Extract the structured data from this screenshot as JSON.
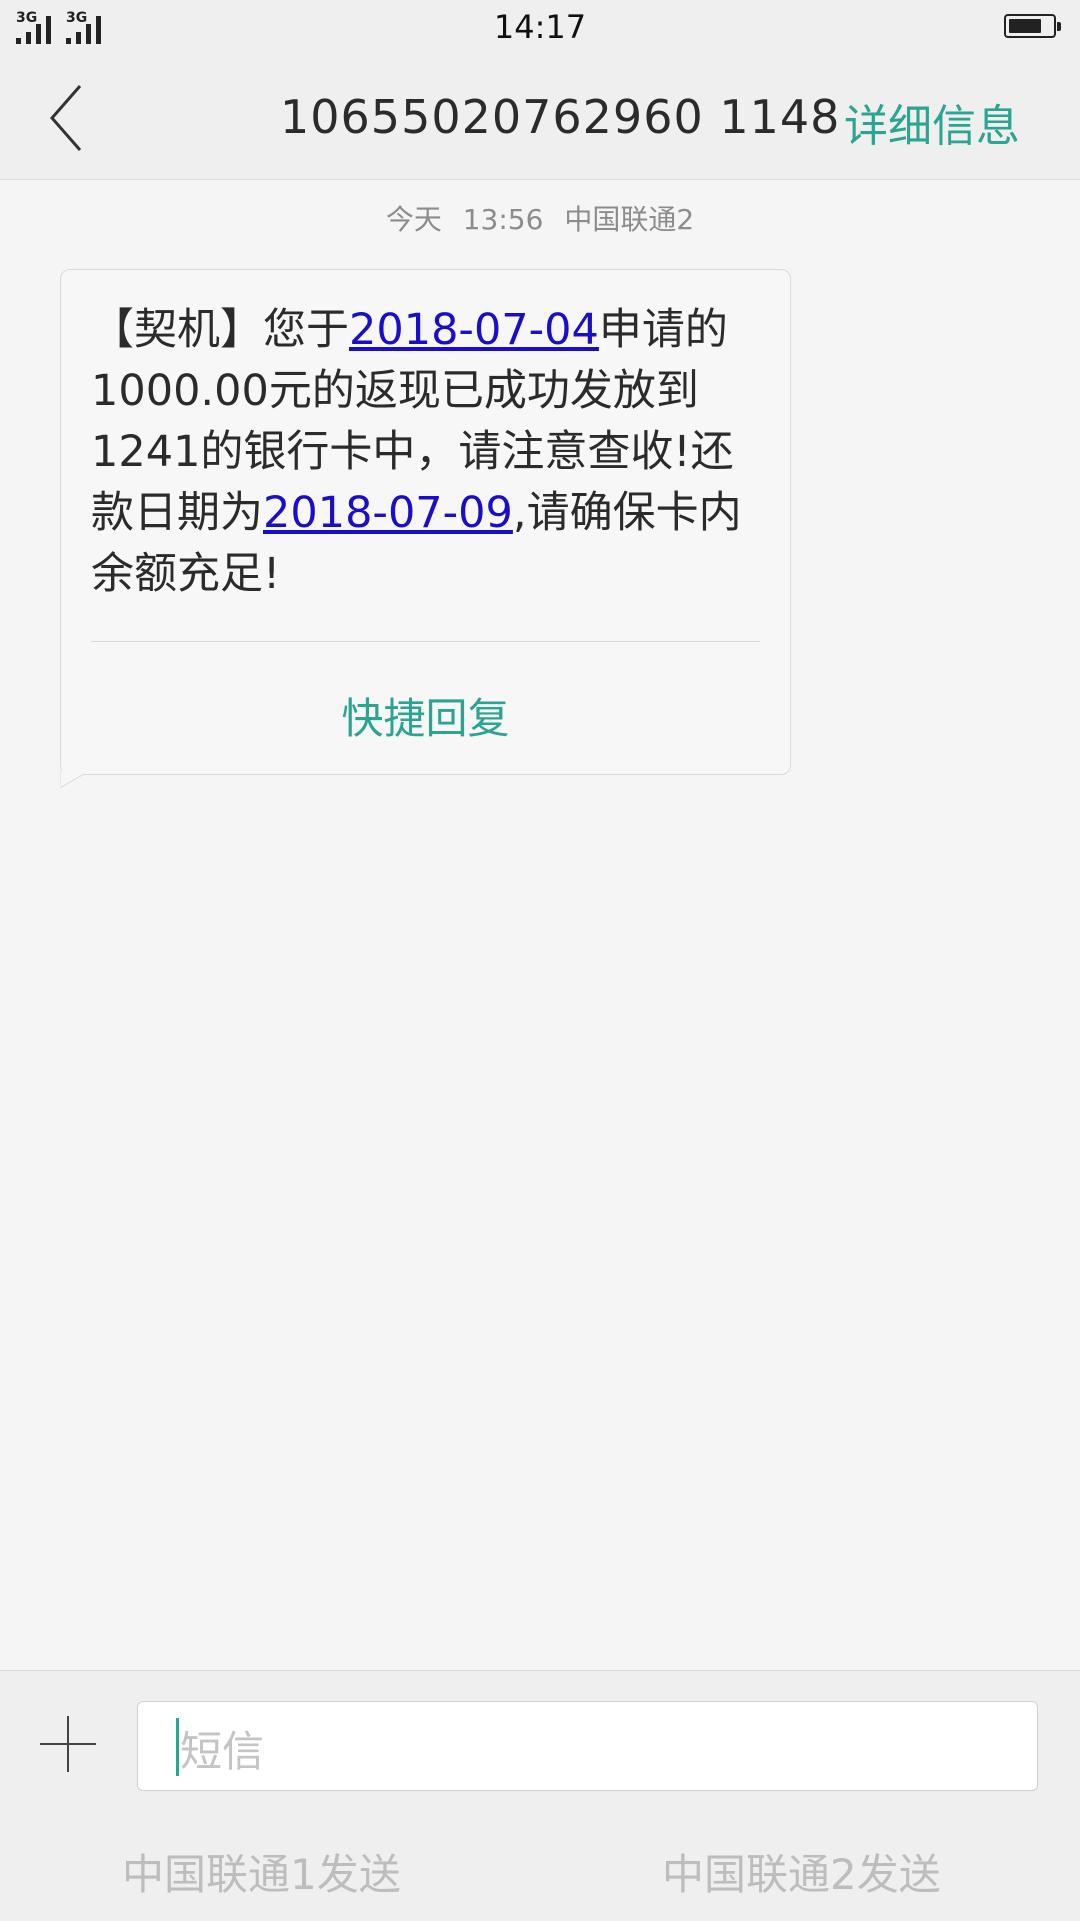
{
  "status_bar": {
    "time": "14:17",
    "sim1_network": "3G",
    "sim2_network": "3G"
  },
  "header": {
    "title": "10655020762960 1148",
    "details_label": "详细信息"
  },
  "conversation": {
    "timestamp_day": "今天",
    "timestamp_time": "13:56",
    "timestamp_sim": "中国联通2",
    "message": {
      "part1": "【契机】您于",
      "link1": "2018-07-04",
      "part2": "申请的1000.00元的返现已成功发放到1241的银行卡中，请注意查收!还款日期为",
      "link2": "2018-07-09",
      "part3": ",请确保卡内余额充足!"
    },
    "quick_reply_label": "快捷回复"
  },
  "composer": {
    "placeholder": "短信",
    "send_sim1_label": "中国联通1发送",
    "send_sim2_label": "中国联通2发送"
  },
  "colors": {
    "accent": "#2aa592",
    "link": "#1a0dcc"
  }
}
